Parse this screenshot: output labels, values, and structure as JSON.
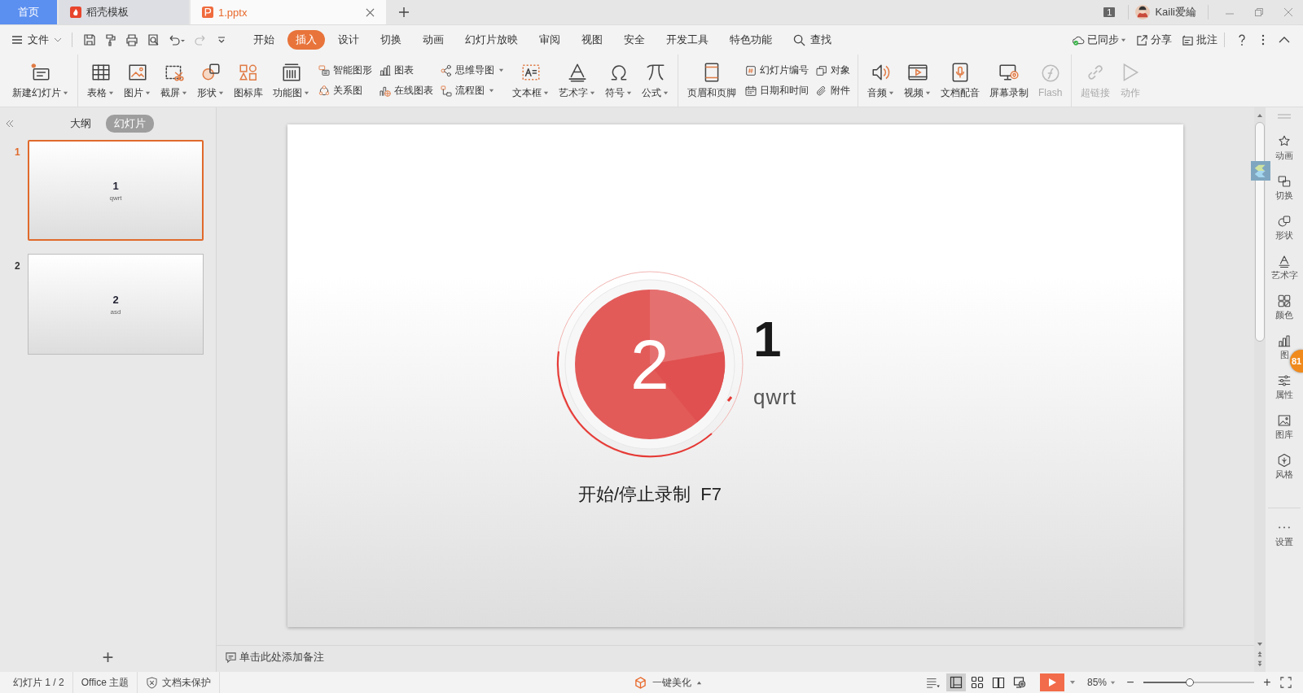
{
  "title_bar": {
    "tabs": [
      {
        "label": "首页",
        "kind": "home",
        "selected": false
      },
      {
        "label": "稻壳模板",
        "kind": "docer",
        "selected": false
      },
      {
        "label": "1.pptx",
        "kind": "doc",
        "selected": true
      }
    ],
    "window_count": "1",
    "user": "Kaili爱綸"
  },
  "menu": {
    "file": "文件",
    "tabs": [
      {
        "label": "开始",
        "selected": false
      },
      {
        "label": "插入",
        "selected": true
      },
      {
        "label": "设计",
        "selected": false
      },
      {
        "label": "切换",
        "selected": false
      },
      {
        "label": "动画",
        "selected": false
      },
      {
        "label": "幻灯片放映",
        "selected": false
      },
      {
        "label": "审阅",
        "selected": false
      },
      {
        "label": "视图",
        "selected": false
      },
      {
        "label": "安全",
        "selected": false
      },
      {
        "label": "开发工具",
        "selected": false
      },
      {
        "label": "特色功能",
        "selected": false
      }
    ],
    "search": "查找",
    "sync": "已同步",
    "share": "分享",
    "comment": "批注"
  },
  "ribbon": {
    "groups": [
      {
        "items": [
          {
            "kind": "large",
            "label": "新建幻灯片",
            "dropdown": true,
            "disabled": false
          }
        ]
      },
      {
        "items": [
          {
            "kind": "large",
            "label": "表格",
            "dropdown": true,
            "disabled": false
          },
          {
            "kind": "large",
            "label": "图片",
            "dropdown": true,
            "disabled": false
          },
          {
            "kind": "large",
            "label": "截屏",
            "dropdown": true,
            "disabled": false
          },
          {
            "kind": "large",
            "label": "形状",
            "dropdown": true,
            "disabled": false
          },
          {
            "kind": "large",
            "label": "图标库",
            "dropdown": false,
            "disabled": false
          },
          {
            "kind": "large",
            "label": "功能图",
            "dropdown": true,
            "disabled": false
          },
          {
            "kind": "stack",
            "items": [
              {
                "label": "智能图形",
                "dropdown": false
              },
              {
                "label": "关系图",
                "dropdown": false
              }
            ]
          },
          {
            "kind": "stack",
            "items": [
              {
                "label": "图表",
                "dropdown": false
              },
              {
                "label": "在线图表",
                "dropdown": false
              }
            ]
          },
          {
            "kind": "stack",
            "items": [
              {
                "label": "思维导图",
                "dropdown": true
              },
              {
                "label": "流程图",
                "dropdown": true
              }
            ]
          },
          {
            "kind": "large",
            "label": "文本框",
            "dropdown": true,
            "disabled": false
          },
          {
            "kind": "large",
            "label": "艺术字",
            "dropdown": true,
            "disabled": false
          },
          {
            "kind": "large",
            "label": "符号",
            "dropdown": true,
            "disabled": false
          },
          {
            "kind": "large",
            "label": "公式",
            "dropdown": true,
            "disabled": false
          }
        ]
      },
      {
        "items": [
          {
            "kind": "large",
            "label": "页眉和页脚",
            "dropdown": false,
            "disabled": false
          },
          {
            "kind": "stack",
            "items": [
              {
                "label": "幻灯片编号",
                "dropdown": false
              },
              {
                "label": "日期和时间",
                "dropdown": false
              }
            ]
          },
          {
            "kind": "stack",
            "items": [
              {
                "label": "对象",
                "dropdown": false
              },
              {
                "label": "附件",
                "dropdown": false
              }
            ]
          }
        ]
      },
      {
        "items": [
          {
            "kind": "large",
            "label": "音频",
            "dropdown": true,
            "disabled": false
          },
          {
            "kind": "large",
            "label": "视频",
            "dropdown": true,
            "disabled": false
          },
          {
            "kind": "large",
            "label": "文档配音",
            "dropdown": false,
            "disabled": false
          },
          {
            "kind": "large",
            "label": "屏幕录制",
            "dropdown": false,
            "disabled": false
          },
          {
            "kind": "large",
            "label": "Flash",
            "dropdown": false,
            "disabled": true
          }
        ]
      },
      {
        "items": [
          {
            "kind": "large",
            "label": "超链接",
            "dropdown": false,
            "disabled": true
          },
          {
            "kind": "large",
            "label": "动作",
            "dropdown": false,
            "disabled": true
          }
        ]
      }
    ]
  },
  "left_panel": {
    "tabs": [
      {
        "label": "大纲",
        "selected": false
      },
      {
        "label": "幻灯片",
        "selected": true
      }
    ],
    "thumbnails": [
      {
        "number": "1",
        "title": "1",
        "subtitle": "qwrt",
        "selected": true
      },
      {
        "number": "2",
        "title": "2",
        "subtitle": "asd",
        "selected": false
      }
    ],
    "add": "+"
  },
  "slide": {
    "title": "1",
    "subtitle": "qwrt"
  },
  "recording_overlay": {
    "countdown": "2",
    "hint": "开始/停止录制  F7"
  },
  "notes": {
    "placeholder": "单击此处添加备注"
  },
  "right_sidebar": {
    "items": [
      {
        "label": "动画"
      },
      {
        "label": "切换"
      },
      {
        "label": "形状"
      },
      {
        "label": "艺术字"
      },
      {
        "label": "颜色"
      },
      {
        "label": "图"
      },
      {
        "label": "属性"
      },
      {
        "label": "图库"
      },
      {
        "label": "风格"
      },
      {
        "label": "设置"
      }
    ],
    "badge": "81"
  },
  "status_bar": {
    "slide_count": "幻灯片 1 / 2",
    "theme": "Office 主题",
    "protection": "文档未保护",
    "beautify": "一键美化",
    "views": [
      {
        "selected": true
      },
      {
        "selected": false
      },
      {
        "selected": false
      },
      {
        "selected": false
      }
    ],
    "zoom": "85%",
    "zoom_out": "−",
    "zoom_in": "+",
    "zoom_level": {
      "level": 0.42
    }
  }
}
